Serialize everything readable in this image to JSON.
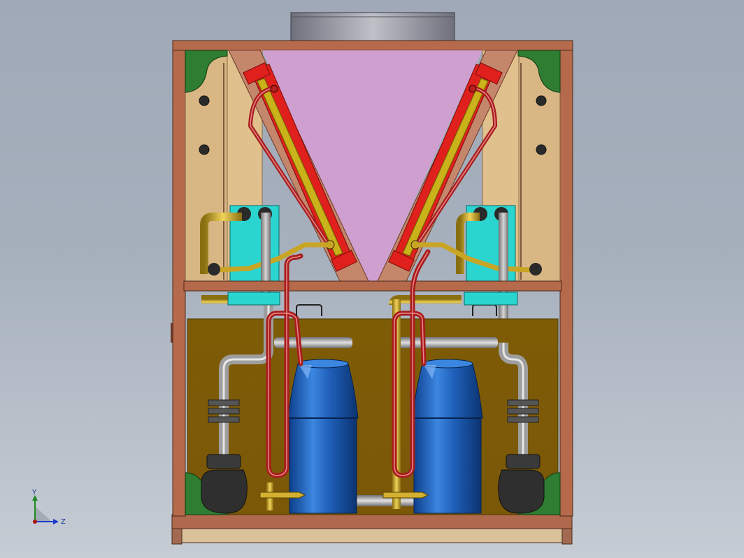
{
  "triad": {
    "y_label": "Y",
    "z_label": "Z"
  },
  "colors": {
    "background_top": "#9fa9b7",
    "frame": "#b56a4b",
    "frame_dark": "#6b3a2a",
    "panel": "#d9b784",
    "lower_cabinet": "#7a5a08",
    "coil_fill": "#cfa0cf",
    "refrigerant_pipe": "#a81c1c",
    "suction_pipe": "#9e9e9e",
    "brass_pipe": "#c9a526",
    "compressor": "#1f5fb8",
    "heat_exchanger": "#2ad4cf",
    "fan_shroud": "#7a7a86",
    "coil_header": "#e0201c",
    "corner_brace": "#2e7d32"
  },
  "icons": {
    "triad": "coordinate-axes-icon",
    "fan": "fan-shroud-icon",
    "compressor": "compressor-icon"
  }
}
